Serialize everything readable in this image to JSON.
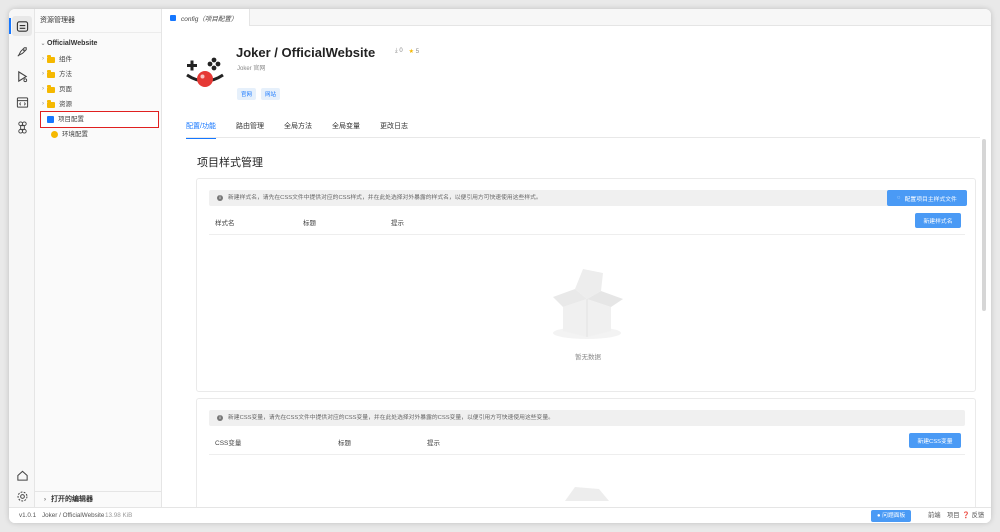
{
  "explorer": {
    "title": "资源管理器",
    "root": "OfficialWebsite",
    "items": [
      {
        "label": "组件",
        "type": "folder"
      },
      {
        "label": "方法",
        "type": "folder"
      },
      {
        "label": "页面",
        "type": "folder"
      },
      {
        "label": "资源",
        "type": "folder"
      },
      {
        "label": "项目配置",
        "type": "config"
      },
      {
        "label": "环境配置",
        "type": "env"
      }
    ],
    "open_editors": "打开的编辑器"
  },
  "editor_tab": {
    "label": "config（项目配置）"
  },
  "project": {
    "title": "Joker / OfficialWebsite",
    "downloads": "0",
    "stars": "5",
    "subtitle": "Joker 官网",
    "tags": [
      "官网",
      "网站"
    ]
  },
  "nav_tabs": [
    "配置/功能",
    "路由管理",
    "全局方法",
    "全局变量",
    "更改日志"
  ],
  "section_title": "项目样式管理",
  "style_card": {
    "notice": "新建样式名，请先在CSS文件中提供对应的CSS样式，并在此处选择对外暴露的样式名，以便引用方可快速使用这些样式。",
    "config_button": "配置项目主样式文件",
    "columns": [
      "样式名",
      "标题",
      "提示"
    ],
    "new_button": "新建样式名",
    "empty": "暂无数据"
  },
  "var_card": {
    "notice": "新建CSS变量，请先在CSS文件中提供对应的CSS变量，并在此处选择对外暴露的CSS变量，以便引用方可快速使用这些变量。",
    "columns": [
      "CSS变量",
      "标题",
      "提示"
    ],
    "new_button": "新建CSS变量"
  },
  "statusbar": {
    "version": "v1.0.1",
    "project": "Joker / OfficialWebsite",
    "size": "13.98 KiB",
    "issue_button": "问题面板",
    "items": [
      "前端",
      "项目"
    ],
    "feedback": "反馈"
  },
  "colors": {
    "accent": "#1677ff",
    "button": "#4a9af5",
    "folder": "#f5b800",
    "selected_outline": "#e02020"
  }
}
